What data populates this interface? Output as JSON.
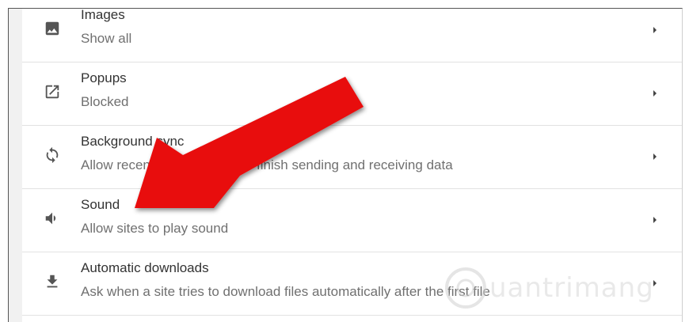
{
  "settings": {
    "items": [
      {
        "title": "Images",
        "subtitle": "Show all",
        "icon": "image-icon"
      },
      {
        "title": "Popups",
        "subtitle": "Blocked",
        "icon": "open-in-new-icon"
      },
      {
        "title": "Background sync",
        "subtitle": "Allow recently closed sites to finish sending and receiving data",
        "icon": "sync-icon"
      },
      {
        "title": "Sound",
        "subtitle": "Allow sites to play sound",
        "icon": "volume-icon"
      },
      {
        "title": "Automatic downloads",
        "subtitle": "Ask when a site tries to download files automatically after the first file",
        "icon": "download-icon"
      }
    ]
  },
  "colors": {
    "arrow": "#e8090b",
    "text_primary": "#333333",
    "text_secondary": "#707070",
    "divider": "#e2e2e2"
  },
  "watermark": {
    "text": "uantrimang"
  }
}
